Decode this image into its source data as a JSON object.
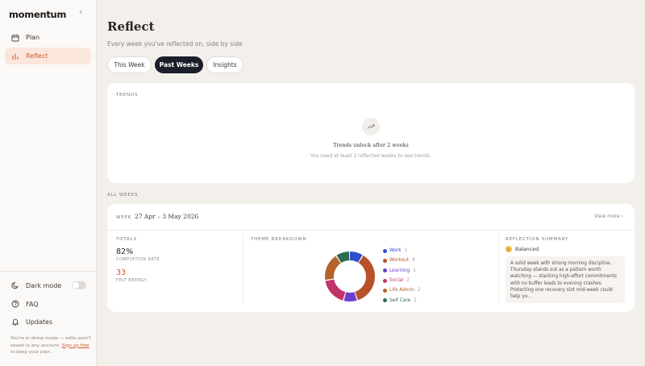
{
  "sidebar": {
    "logo": "momentum",
    "collapse_glyph": "‹",
    "nav": [
      {
        "label": "Plan",
        "icon": "calendar-icon",
        "active": false
      },
      {
        "label": "Reflect",
        "icon": "bar-chart-icon",
        "active": true
      }
    ],
    "bottom": [
      {
        "label": "Dark mode",
        "icon": "moon-icon"
      },
      {
        "label": "FAQ",
        "icon": "question-icon"
      },
      {
        "label": "Updates",
        "icon": "bell-icon"
      }
    ],
    "dark_mode_on": false,
    "demo_note_prefix": "You're in demo mode — edits aren't saved to any account.",
    "demo_note_link": "Sign up free",
    "demo_note_suffix": "to keep your plan."
  },
  "header": {
    "title": "Reflect",
    "subtitle": "Every week you've reflected on, side by side"
  },
  "tabs": [
    {
      "label": "This Week",
      "active": false
    },
    {
      "label": "Past Weeks",
      "active": true
    },
    {
      "label": "Insights",
      "active": false
    }
  ],
  "trends": {
    "label": "TRENDS",
    "icon": "trending-up-icon",
    "title": "Trends unlock after 2 weeks",
    "description": "You need at least 2 reflected weeks to see trends."
  },
  "all_weeks": {
    "label": "ALL WEEKS"
  },
  "week": {
    "label": "WEEK",
    "range": "27 Apr – 3 May 2026",
    "view_more": "View more",
    "totals": {
      "label": "TOTALS",
      "completion_value": "82%",
      "completion_caption": "COMPLETION RATE",
      "energy_value": "33",
      "energy_caption": "FELT ENERGY"
    },
    "theme_breakdown": {
      "label": "THEME BREAKDOWN",
      "themes": [
        {
          "name": "Work",
          "count": "1",
          "color": "#2f4fcf"
        },
        {
          "name": "Workout",
          "count": "4",
          "color": "#b8502a"
        },
        {
          "name": "Learning",
          "count": "1",
          "color": "#6a3fd0"
        },
        {
          "name": "Social",
          "count": "2",
          "color": "#c2336a"
        },
        {
          "name": "Life Admin",
          "count": "2",
          "color": "#b5632b"
        },
        {
          "name": "Self Care",
          "count": "1",
          "color": "#2f6b4f"
        }
      ]
    },
    "summary": {
      "label": "REFLECTION SUMMARY",
      "mood": "Balanced",
      "text": "A solid week with strong morning discipline. Thursday stands out as a pattern worth watching — stacking high-effort commitments with no buffer leads to evening crashes. Protecting one recovery slot mid-week could help yo..."
    }
  },
  "colors": {
    "accent": "#d1562e",
    "active_tab": "#1a1f2b"
  }
}
